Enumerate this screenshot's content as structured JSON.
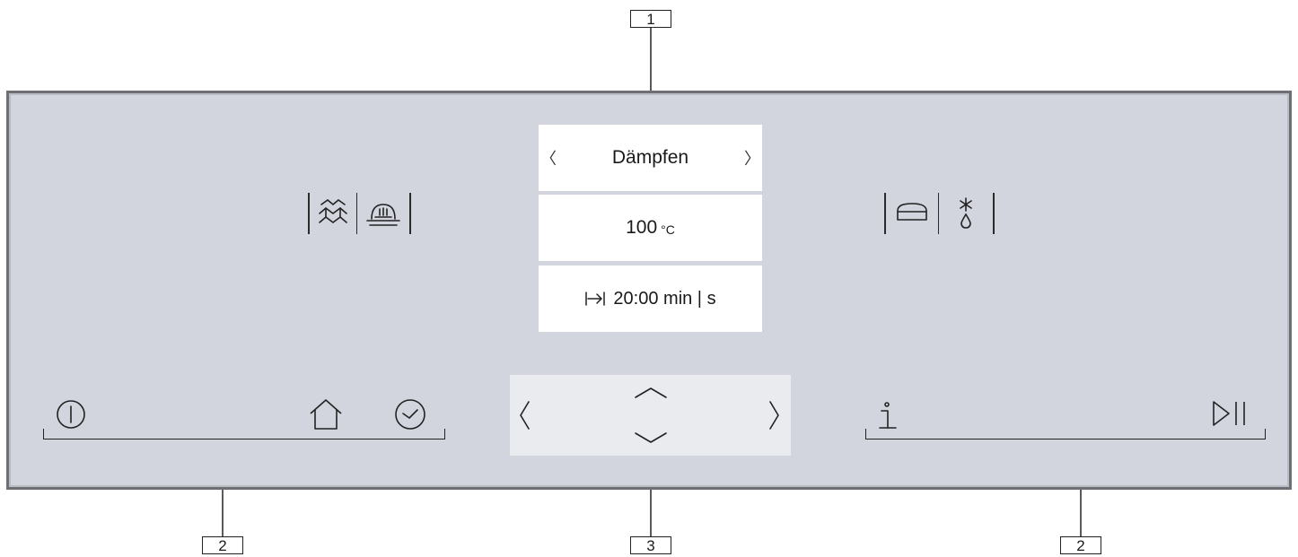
{
  "callouts": {
    "top": "1",
    "bottom_left": "2",
    "bottom_center": "3",
    "bottom_right": "2"
  },
  "display": {
    "program": "Dämpfen",
    "temperature_value": "100",
    "temperature_unit": "°C",
    "duration": "20:00 min | s"
  },
  "icons": {
    "left_modes": [
      "steam-waves-icon",
      "steam-cooking-icon"
    ],
    "right_modes": [
      "container-icon",
      "drip-defrost-icon"
    ],
    "left_controls": [
      "power-icon",
      "home-icon",
      "timer-icon"
    ],
    "navigation": [
      "nav-left-icon",
      "nav-up-icon",
      "nav-down-icon",
      "nav-right-icon"
    ],
    "right_controls": [
      "info-icon",
      "play-pause-icon"
    ]
  }
}
